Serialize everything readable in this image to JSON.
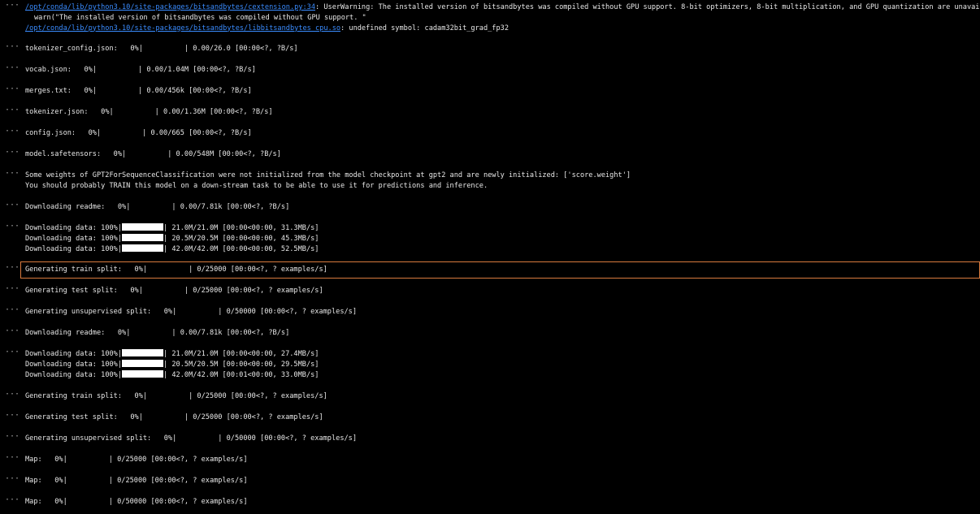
{
  "warning_block": {
    "link1": "/opt/conda/lib/python3.10/site-packages/bitsandbytes/cextension.py:34",
    "text1": ": UserWarning: The installed version of bitsandbytes was compiled without GPU support. 8-bit optimizers, 8-bit multiplication, and GPU quantization are unavailable.",
    "text2": "warn(\"The installed version of bitsandbytes was compiled without GPU support. \"",
    "link2": "/opt/conda/lib/python3.10/site-packages/bitsandbytes/libbitsandbytes_cpu.so",
    "text3": ": undefined symbol: cadam32bit_grad_fp32"
  },
  "cell_menu_glyph": "···",
  "outputs": [
    {
      "label": "tokenizer_config.json:",
      "pct": "0%|",
      "progress": 0.0,
      "stats": "| 0.00/26.0 [00:00<?, ?B/s]"
    },
    {
      "label": "vocab.json:",
      "pct": "0%|",
      "progress": 0.0,
      "stats": "| 0.00/1.04M [00:00<?, ?B/s]"
    },
    {
      "label": "merges.txt:",
      "pct": "0%|",
      "progress": 0.0,
      "stats": "| 0.00/456k [00:00<?, ?B/s]"
    },
    {
      "label": "tokenizer.json:",
      "pct": "0%|",
      "progress": 0.0,
      "stats": "| 0.00/1.36M [00:00<?, ?B/s]"
    },
    {
      "label": "config.json:",
      "pct": "0%|",
      "progress": 0.0,
      "stats": "| 0.00/665 [00:00<?, ?B/s]"
    },
    {
      "label": "model.safetensors:",
      "pct": "0%|",
      "progress": 0.0,
      "stats": "| 0.00/548M [00:00<?, ?B/s]"
    }
  ],
  "weights_notice": {
    "line1": "Some weights of GPT2ForSequenceClassification were not initialized from the model checkpoint at gpt2 and are newly initialized: ['score.weight']",
    "line2": "You should probably TRAIN this model on a down-stream task to be able to use it for predictions and inference."
  },
  "readme1": {
    "label": "Downloading readme:",
    "pct": "0%|",
    "progress": 0.0,
    "stats": "| 0.00/7.81k [00:00<?, ?B/s]"
  },
  "download_group1": [
    {
      "label": "Downloading data:",
      "pct": "100%|",
      "progress": 1.0,
      "stats": "| 21.0M/21.0M [00:00<00:00, 31.3MB/s]"
    },
    {
      "label": "Downloading data:",
      "pct": "100%|",
      "progress": 1.0,
      "stats": "| 20.5M/20.5M [00:00<00:00, 45.3MB/s]"
    },
    {
      "label": "Downloading data:",
      "pct": "100%|",
      "progress": 1.0,
      "stats": "| 42.0M/42.0M [00:00<00:00, 52.5MB/s]"
    }
  ],
  "splits1": [
    {
      "label": "Generating train split:",
      "pct": "0%|",
      "progress": 0.0,
      "stats": "| 0/25000 [00:00<?, ? examples/s]",
      "selected": true
    },
    {
      "label": "Generating test split:",
      "pct": "0%|",
      "progress": 0.0,
      "stats": "| 0/25000 [00:00<?, ? examples/s]"
    },
    {
      "label": "Generating unsupervised split:",
      "pct": "0%|",
      "progress": 0.0,
      "stats": "| 0/50000 [00:00<?, ? examples/s]"
    }
  ],
  "readme2": {
    "label": "Downloading readme:",
    "pct": "0%|",
    "progress": 0.0,
    "stats": "| 0.00/7.81k [00:00<?, ?B/s]"
  },
  "download_group2": [
    {
      "label": "Downloading data:",
      "pct": "100%|",
      "progress": 1.0,
      "stats": "| 21.0M/21.0M [00:00<00:00, 27.4MB/s]"
    },
    {
      "label": "Downloading data:",
      "pct": "100%|",
      "progress": 1.0,
      "stats": "| 20.5M/20.5M [00:00<00:00, 29.5MB/s]"
    },
    {
      "label": "Downloading data:",
      "pct": "100%|",
      "progress": 1.0,
      "stats": "| 42.0M/42.0M [00:01<00:00, 33.0MB/s]"
    }
  ],
  "splits2": [
    {
      "label": "Generating train split:",
      "pct": "0%|",
      "progress": 0.0,
      "stats": "| 0/25000 [00:00<?, ? examples/s]"
    },
    {
      "label": "Generating test split:",
      "pct": "0%|",
      "progress": 0.0,
      "stats": "| 0/25000 [00:00<?, ? examples/s]"
    },
    {
      "label": "Generating unsupervised split:",
      "pct": "0%|",
      "progress": 0.0,
      "stats": "| 0/50000 [00:00<?, ? examples/s]"
    }
  ],
  "maps": [
    {
      "label": "Map:",
      "pct": "0%|",
      "progress": 0.0,
      "stats": "| 0/25000 [00:00<?, ? examples/s]"
    },
    {
      "label": "Map:",
      "pct": "0%|",
      "progress": 0.0,
      "stats": "| 0/25000 [00:00<?, ? examples/s]"
    },
    {
      "label": "Map:",
      "pct": "0%|",
      "progress": 0.0,
      "stats": "| 0/50000 [00:00<?, ? examples/s]"
    }
  ],
  "colors": {
    "background": "#000000",
    "text": "#e8e8e8",
    "link": "#3a8cff",
    "selection_border": "#d87a3e",
    "progress_fill": "#ffffff"
  }
}
